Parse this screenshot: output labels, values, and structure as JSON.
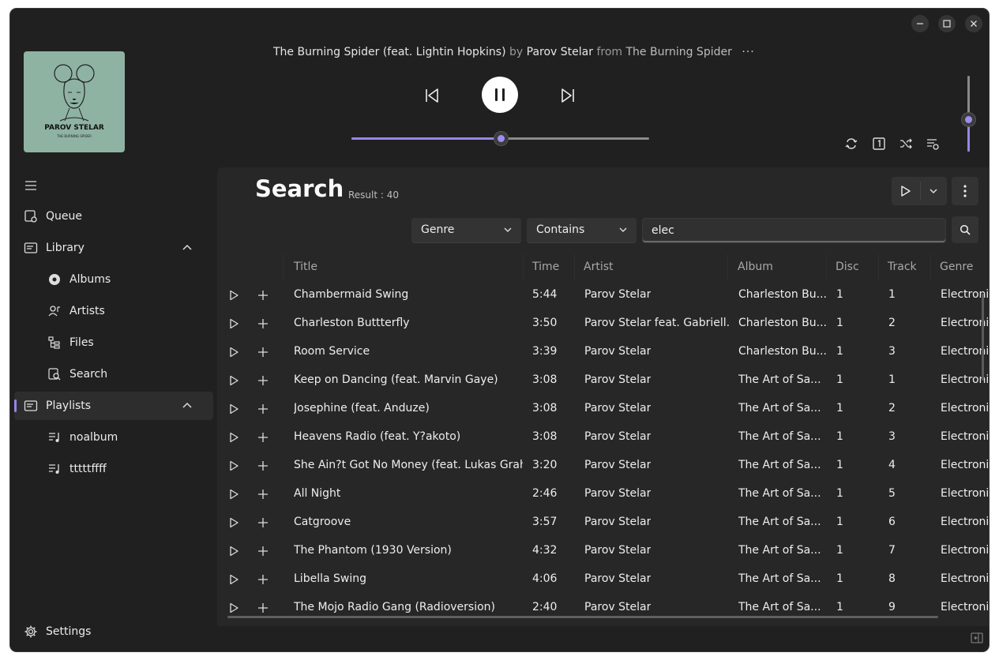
{
  "colors": {
    "accent": "#9a84e6",
    "background": "#202020",
    "panel": "#272727"
  },
  "window_controls": [
    "minimize-icon",
    "maximize-icon",
    "close-icon"
  ],
  "now_playing": {
    "title": "The Burning Spider (feat. Lightin Hopkins)",
    "by_label": "by",
    "artist": "Parov Stelar",
    "from_label": "from",
    "album": "The Burning Spider",
    "more": "···",
    "cover_artist_text": "PAROV STELAR",
    "cover_subtitle_text": "THE BURNING SPIDER",
    "progress_fraction": 0.5,
    "volume_fraction": 0.43
  },
  "player_icons": [
    "skip-previous-icon",
    "pause-icon",
    "skip-next-icon",
    "repeat-icon",
    "repeat-one-icon",
    "shuffle-icon",
    "queue-settings-icon"
  ],
  "sidebar": {
    "menu_icon": "hamburger-icon",
    "items": [
      {
        "label": "Queue",
        "icon": "queue-icon"
      },
      {
        "label": "Library",
        "icon": "library-icon"
      },
      {
        "label": "Albums",
        "icon": "album-icon"
      },
      {
        "label": "Artists",
        "icon": "artist-icon"
      },
      {
        "label": "Files",
        "icon": "files-icon"
      },
      {
        "label": "Search",
        "icon": "search-icon"
      },
      {
        "label": "Playlists",
        "icon": "playlists-icon"
      },
      {
        "label": "noalbum",
        "icon": "playlist-icon"
      },
      {
        "label": "tttttffff",
        "icon": "playlist-icon"
      }
    ],
    "settings": {
      "label": "Settings",
      "icon": "gear-icon"
    }
  },
  "search": {
    "title": "Search",
    "result_label": "Result :",
    "result_count": "40",
    "field_dropdown": "Genre",
    "match_dropdown": "Contains",
    "query": "elec"
  },
  "table": {
    "columns": [
      "Title",
      "Time",
      "Artist",
      "Album",
      "Disc",
      "Track",
      "Genre"
    ],
    "rows": [
      [
        "Chambermaid Swing",
        "5:44",
        "Parov Stelar",
        "Charleston Bu...",
        "1",
        "1",
        "Electronic"
      ],
      [
        "Charleston Buttterfly",
        "3:50",
        "Parov Stelar feat. Gabriell...",
        "Charleston Bu...",
        "1",
        "2",
        "Electronic"
      ],
      [
        "Room Service",
        "3:39",
        "Parov Stelar",
        "Charleston Bu...",
        "1",
        "3",
        "Electronic"
      ],
      [
        "Keep on Dancing (feat. Marvin Gaye)",
        "3:08",
        "Parov Stelar",
        "The Art of Sa...",
        "1",
        "1",
        "Electronic"
      ],
      [
        "Josephine (feat. Anduze)",
        "3:08",
        "Parov Stelar",
        "The Art of Sa...",
        "1",
        "2",
        "Electronic"
      ],
      [
        "Heavens Radio (feat. Y?akoto)",
        "3:08",
        "Parov Stelar",
        "The Art of Sa...",
        "1",
        "3",
        "Electronic"
      ],
      [
        "She Ain?t Got No Money (feat. Lukas Grah...",
        "3:20",
        "Parov Stelar",
        "The Art of Sa...",
        "1",
        "4",
        "Electronic"
      ],
      [
        "All Night",
        "2:46",
        "Parov Stelar",
        "The Art of Sa...",
        "1",
        "5",
        "Electronic"
      ],
      [
        "Catgroove",
        "3:57",
        "Parov Stelar",
        "The Art of Sa...",
        "1",
        "6",
        "Electronic"
      ],
      [
        "The Phantom (1930 Version)",
        "4:32",
        "Parov Stelar",
        "The Art of Sa...",
        "1",
        "7",
        "Electronic"
      ],
      [
        "Libella Swing",
        "4:06",
        "Parov Stelar",
        "The Art of Sa...",
        "1",
        "8",
        "Electronic"
      ],
      [
        "The Mojo Radio Gang (Radioversion)",
        "2:40",
        "Parov Stelar",
        "The Art of Sa...",
        "1",
        "9",
        "Electronic"
      ]
    ]
  }
}
